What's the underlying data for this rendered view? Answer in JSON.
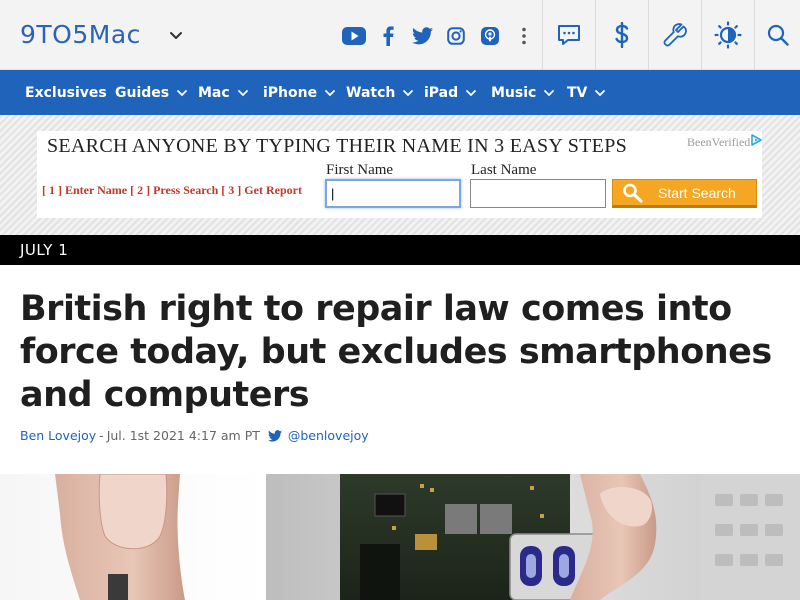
{
  "header": {
    "logo_text": "9TO5Mac",
    "social": [
      {
        "name": "youtube-icon"
      },
      {
        "name": "facebook-icon"
      },
      {
        "name": "twitter-icon"
      },
      {
        "name": "instagram-icon"
      },
      {
        "name": "podcast-icon"
      }
    ],
    "buttons": [
      {
        "name": "more-icon"
      },
      {
        "name": "comments-icon"
      },
      {
        "name": "deals-icon"
      },
      {
        "name": "tools-icon"
      },
      {
        "name": "theme-toggle-icon"
      },
      {
        "name": "search-icon"
      }
    ]
  },
  "nav": {
    "items": [
      {
        "label": "Exclusives",
        "has_dropdown": false
      },
      {
        "label": "Guides",
        "has_dropdown": true
      },
      {
        "label": "Mac",
        "has_dropdown": true
      },
      {
        "label": "iPhone",
        "has_dropdown": true
      },
      {
        "label": "Watch",
        "has_dropdown": true
      },
      {
        "label": "iPad",
        "has_dropdown": true
      },
      {
        "label": "Music",
        "has_dropdown": true
      },
      {
        "label": "TV",
        "has_dropdown": true
      }
    ]
  },
  "ad": {
    "headline": "SEARCH ANYONE BY TYPING THEIR NAME IN 3 EASY STEPS",
    "brand": "BeenVerified",
    "steps": "[ 1 ] Enter Name [ 2 ] Press Search [ 3 ] Get Report",
    "first_name_label": "First Name",
    "last_name_label": "Last Name",
    "first_name_value": "|",
    "last_name_value": "",
    "button_label": "Start Search"
  },
  "article": {
    "date": "JULY 1",
    "headline": "British right to repair law comes into force today, but excludes smartphones and computers",
    "author": "Ben Lovejoy",
    "separator": "-",
    "timestamp": "Jul. 1st 2021 4:17 am PT",
    "twitter_handle": "@benlovejoy"
  },
  "colors": {
    "brand_blue": "#1f64ba",
    "ad_button": "#f5a623",
    "date_bar": "#000000"
  }
}
